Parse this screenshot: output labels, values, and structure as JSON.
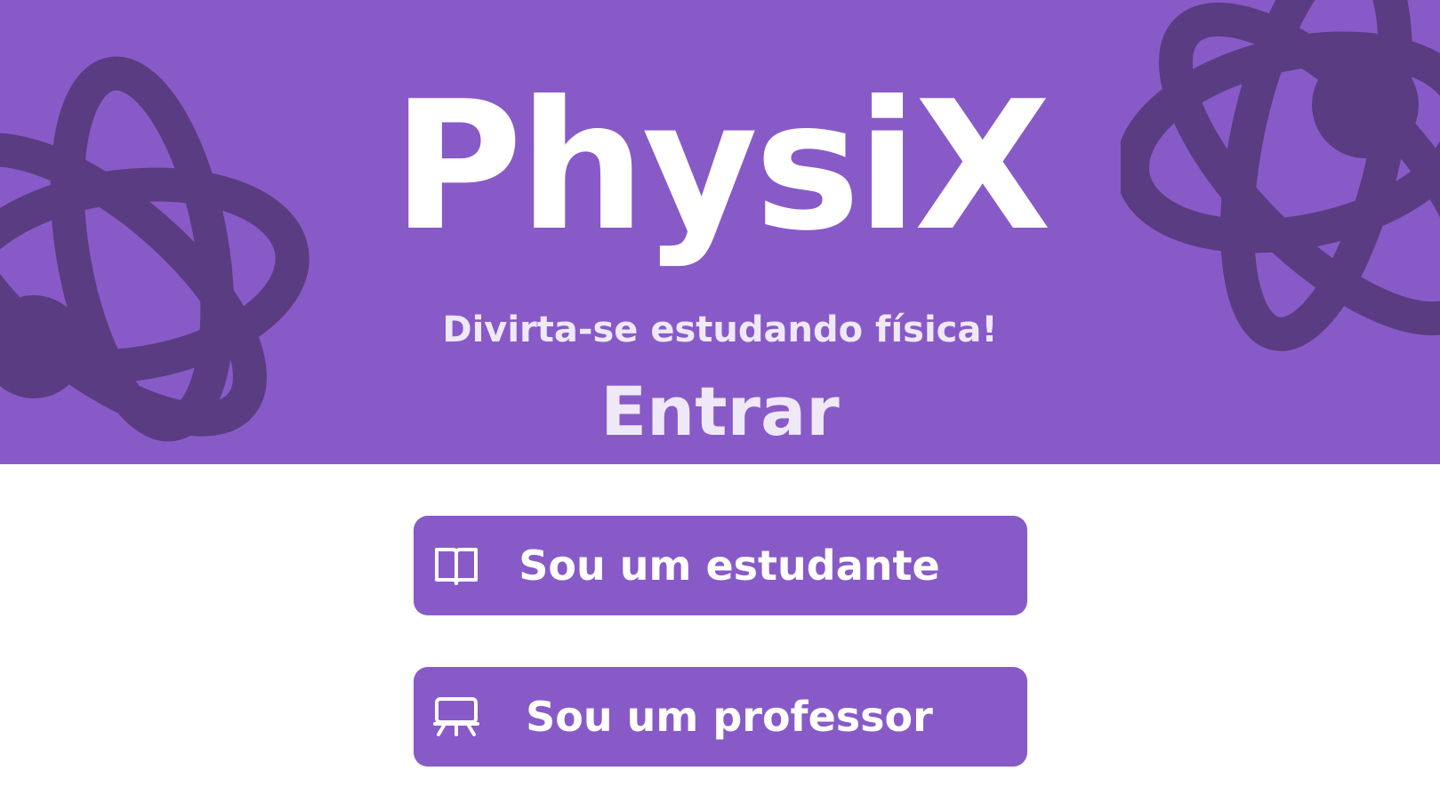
{
  "app": {
    "logo_text": "PhysiX",
    "tagline": "Divirta-se estudando física!",
    "heading": "Entrar"
  },
  "actions": {
    "student_label": "Sou um estudante",
    "teacher_label": "Sou um professor",
    "student_icon": "book-open-icon",
    "teacher_icon": "presentation-board-icon"
  },
  "colors": {
    "primary": "#885ac8",
    "accent_dark": "#5a3c82",
    "text_light": "#efe8f6",
    "white": "#ffffff"
  }
}
